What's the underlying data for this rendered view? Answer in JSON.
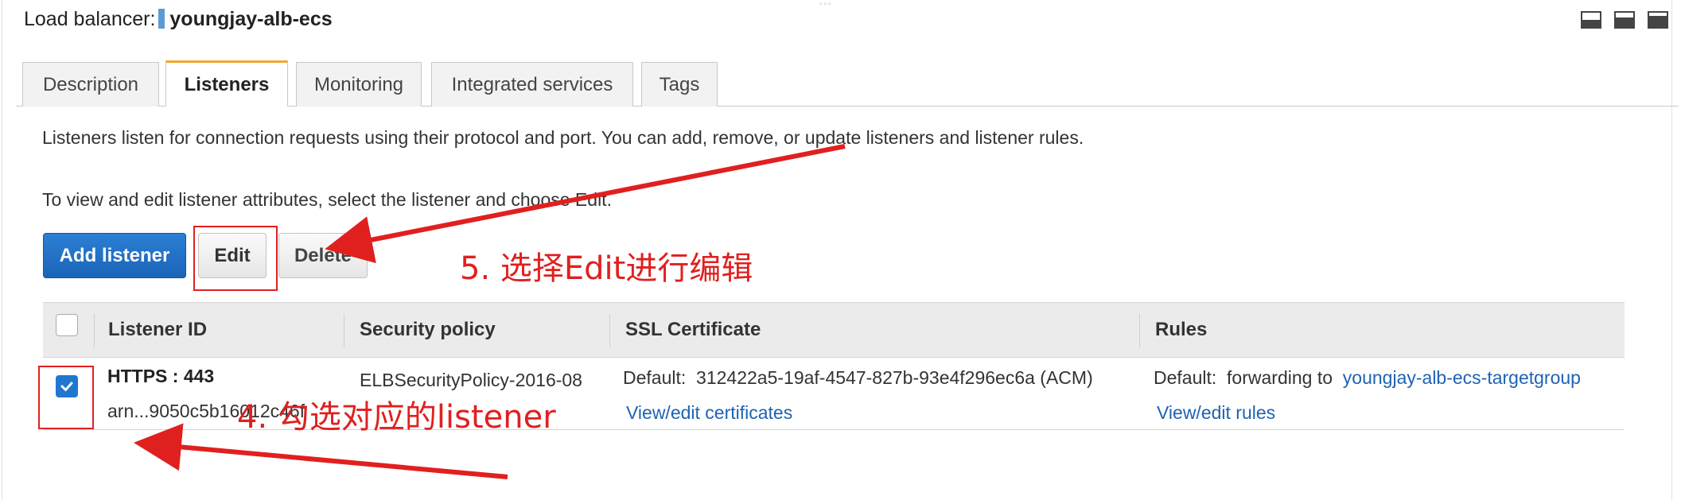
{
  "header": {
    "label": "Load balancer:",
    "name": "youngjay-alb-ecs",
    "view_icons": [
      "panel-bottom-icon",
      "panel-half-icon",
      "panel-top-icon"
    ]
  },
  "tabs": [
    {
      "label": "Description",
      "active": false
    },
    {
      "label": "Listeners",
      "active": true
    },
    {
      "label": "Monitoring",
      "active": false
    },
    {
      "label": "Integrated services",
      "active": false
    },
    {
      "label": "Tags",
      "active": false
    }
  ],
  "intro": {
    "line1": "Listeners listen for connection requests using their protocol and port. You can add, remove, or update listeners and listener rules.",
    "line2": "To view and edit listener attributes, select the listener and choose Edit."
  },
  "actions": {
    "add_label": "Add listener",
    "edit_label": "Edit",
    "delete_label": "Delete"
  },
  "table": {
    "columns": [
      "Listener ID",
      "Security policy",
      "SSL Certificate",
      "Rules"
    ],
    "rows": [
      {
        "checked": true,
        "listener_id": "HTTPS : 443",
        "arn": "arn...9050c5b16012c46f",
        "security_policy": "ELBSecurityPolicy-2016-08",
        "ssl_label": "Default:",
        "ssl_value": "312422a5-19af-4547-827b-93e4f296ec6a (ACM)",
        "ssl_link": "View/edit certificates",
        "rules_label": "Default:",
        "rules_value": "forwarding to",
        "rules_target": "youngjay-alb-ecs-targetgroup",
        "rules_link": "View/edit rules"
      }
    ]
  },
  "annotations": {
    "step5": "5. 选择Edit进行编辑",
    "step4": "4. 勾选对应的listener",
    "color": "#e0201f"
  },
  "colors": {
    "primary_button": "#1f6fc8",
    "link": "#1f62b4",
    "active_tab_accent": "#f0a830",
    "title_marker": "#5b9bd5"
  }
}
